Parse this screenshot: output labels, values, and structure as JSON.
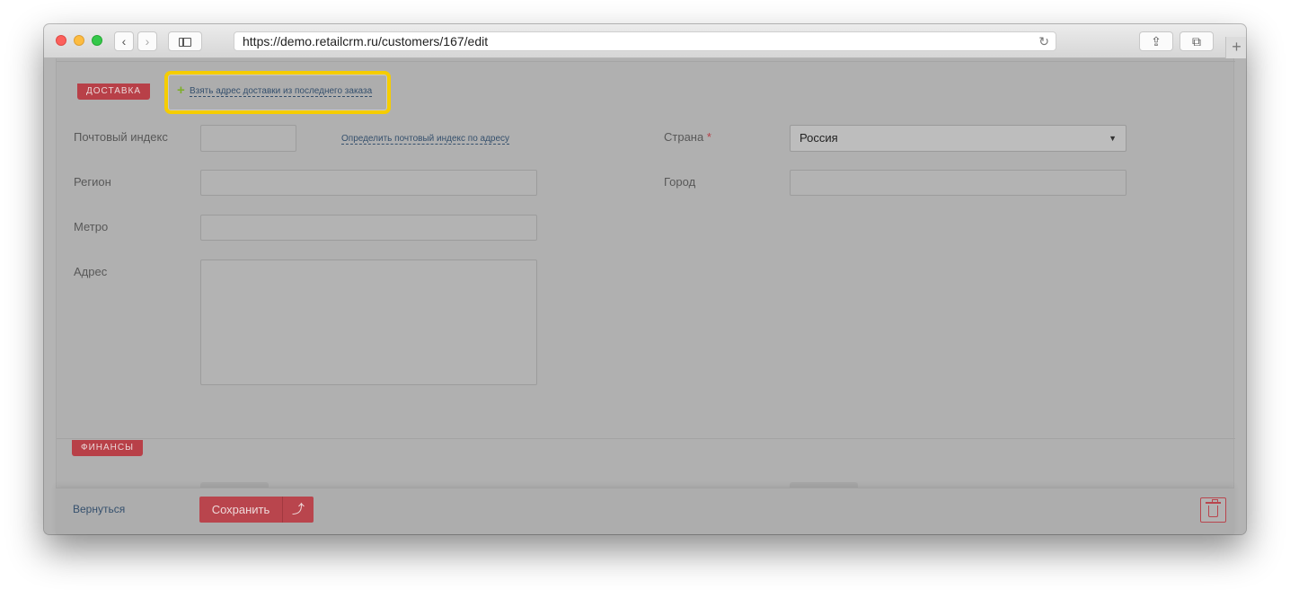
{
  "browser": {
    "url": "https://demo.retailcrm.ru/customers/167/edit",
    "back_glyph": "‹",
    "forward_glyph": "›",
    "reload_glyph": "↻",
    "share_glyph": "⇪",
    "tabs_glyph": "⧉",
    "new_tab_glyph": "+"
  },
  "delivery": {
    "section_title": "ДОСТАВКА",
    "take_address_link": "Взять адрес доставки из последнего заказа",
    "plus_glyph": "+",
    "postcode_label": "Почтовый индекс",
    "postcode_value": "",
    "detect_postcode_link": "Определить почтовый индекс по адресу",
    "region_label": "Регион",
    "region_value": "",
    "metro_label": "Метро",
    "metro_value": "",
    "address_label": "Адрес",
    "address_value": "",
    "country_label": "Страна",
    "required_mark": "*",
    "country_value": "Россия",
    "caret_glyph": "▼",
    "city_label": "Город",
    "city_value": ""
  },
  "finance": {
    "section_title": "ФИНАНСЫ"
  },
  "footer": {
    "back_label": "Вернуться",
    "save_label": "Сохранить",
    "save_dropdown_glyph": "⤴"
  },
  "colors": {
    "accent": "#b9454d",
    "highlight": "#f5cd00",
    "link": "#35506d",
    "plus": "#7fae2a"
  }
}
